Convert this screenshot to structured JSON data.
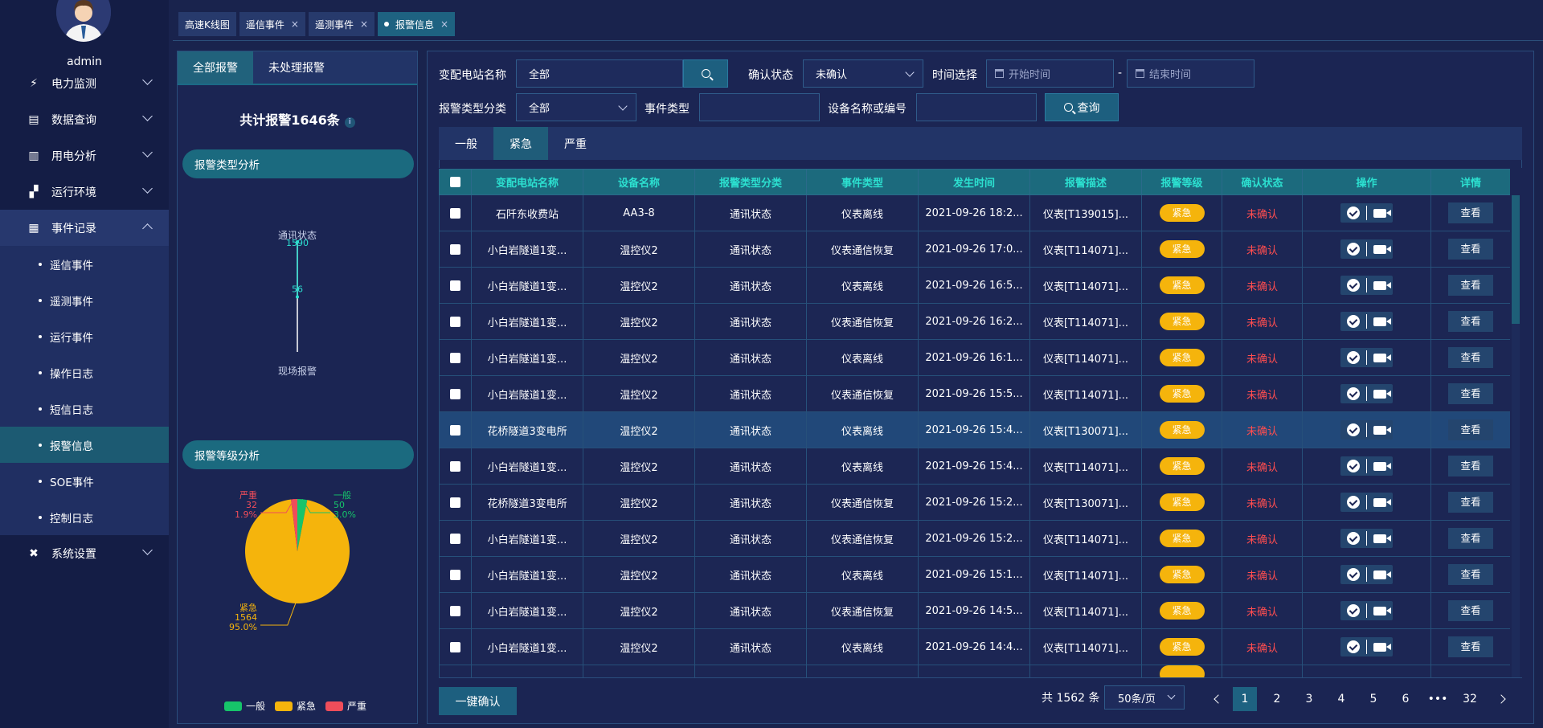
{
  "user": {
    "name": "admin"
  },
  "colors": {
    "accent": "#1e6281",
    "normal": "#16c46a",
    "urgent": "#f5b40c",
    "severe": "#ef4d5a",
    "header_text": "#2ce0d0"
  },
  "sidebar": {
    "menus": [
      {
        "label": "电力监测",
        "icon": "power-icon"
      },
      {
        "label": "数据查询",
        "icon": "database-icon"
      },
      {
        "label": "用电分析",
        "icon": "bar-chart-icon"
      },
      {
        "label": "运行环境",
        "icon": "environment-icon"
      },
      {
        "label": "事件记录",
        "icon": "event-icon",
        "expanded": true
      },
      {
        "label": "系统设置",
        "icon": "settings-icon"
      }
    ],
    "submenu": [
      "遥信事件",
      "遥测事件",
      "运行事件",
      "操作日志",
      "短信日志",
      "报警信息",
      "SOE事件",
      "控制日志"
    ],
    "active_sub": "报警信息"
  },
  "tabs": [
    {
      "label": "高速K线图",
      "closable": false
    },
    {
      "label": "遥信事件",
      "closable": true
    },
    {
      "label": "遥测事件",
      "closable": true
    },
    {
      "label": "报警信息",
      "closable": true,
      "active": true
    }
  ],
  "close_glyph": "×",
  "left_panel": {
    "tabs": [
      "全部报警",
      "未处理报警"
    ],
    "total": "共计报警1646条",
    "info_glyph": "i",
    "type_analysis_title": "报警类型分析",
    "level_analysis_title": "报警等级分析"
  },
  "chart_data": [
    {
      "type": "bar",
      "title": "报警类型分析",
      "categories": [
        "通讯状态",
        "现场报警"
      ],
      "values": [
        1590,
        56
      ],
      "labels": [
        "通讯状态",
        "1590",
        "56",
        "现场报警"
      ]
    },
    {
      "type": "pie",
      "title": "报警等级分析",
      "slices": [
        {
          "name": "一般",
          "value": 50,
          "percent": "3.0%"
        },
        {
          "name": "紧急",
          "value": 1564,
          "percent": "95.0%"
        },
        {
          "name": "严重",
          "value": 32,
          "percent": "1.9%"
        }
      ],
      "legend": [
        "一般",
        "紧急",
        "严重"
      ],
      "legend_position": "bottom"
    }
  ],
  "filters": {
    "station_label": "变配电站名称",
    "station_value": "全部",
    "ack_label": "确认状态",
    "ack_value": "未确认",
    "time_label": "时间选择",
    "start_placeholder": "开始时间",
    "dash": "-",
    "end_placeholder": "结束时间",
    "type_label": "报警类型分类",
    "type_value": "全部",
    "event_label": "事件类型",
    "device_label": "设备名称或编号",
    "query_button": "查询"
  },
  "level_tabs": [
    "一般",
    "紧急",
    "严重"
  ],
  "active_level": "紧急",
  "table": {
    "headers": [
      "变配电站名称",
      "设备名称",
      "报警类型分类",
      "事件类型",
      "发生时间",
      "报警描述",
      "报警等级",
      "确认状态",
      "操作",
      "详情"
    ],
    "rows": [
      {
        "station": "石阡东收费站",
        "device": "AA3-8",
        "category": "通讯状态",
        "event": "仪表离线",
        "time": "2021-09-26 18:2...",
        "desc": "仪表[T139015]...",
        "level": "紧急",
        "status": "未确认",
        "view": "查看"
      },
      {
        "station": "小白岩隧道1变...",
        "device": "温控仪2",
        "category": "通讯状态",
        "event": "仪表通信恢复",
        "time": "2021-09-26 17:0...",
        "desc": "仪表[T114071]...",
        "level": "紧急",
        "status": "未确认",
        "view": "查看"
      },
      {
        "station": "小白岩隧道1变...",
        "device": "温控仪2",
        "category": "通讯状态",
        "event": "仪表离线",
        "time": "2021-09-26 16:5...",
        "desc": "仪表[T114071]...",
        "level": "紧急",
        "status": "未确认",
        "view": "查看"
      },
      {
        "station": "小白岩隧道1变...",
        "device": "温控仪2",
        "category": "通讯状态",
        "event": "仪表通信恢复",
        "time": "2021-09-26 16:2...",
        "desc": "仪表[T114071]...",
        "level": "紧急",
        "status": "未确认",
        "view": "查看"
      },
      {
        "station": "小白岩隧道1变...",
        "device": "温控仪2",
        "category": "通讯状态",
        "event": "仪表离线",
        "time": "2021-09-26 16:1...",
        "desc": "仪表[T114071]...",
        "level": "紧急",
        "status": "未确认",
        "view": "查看"
      },
      {
        "station": "小白岩隧道1变...",
        "device": "温控仪2",
        "category": "通讯状态",
        "event": "仪表通信恢复",
        "time": "2021-09-26 15:5...",
        "desc": "仪表[T114071]...",
        "level": "紧急",
        "status": "未确认",
        "view": "查看"
      },
      {
        "station": "花桥隧道3变电所",
        "device": "温控仪2",
        "category": "通讯状态",
        "event": "仪表离线",
        "time": "2021-09-26 15:4...",
        "desc": "仪表[T130071]...",
        "level": "紧急",
        "status": "未确认",
        "view": "查看",
        "highlight": true
      },
      {
        "station": "小白岩隧道1变...",
        "device": "温控仪2",
        "category": "通讯状态",
        "event": "仪表离线",
        "time": "2021-09-26 15:4...",
        "desc": "仪表[T114071]...",
        "level": "紧急",
        "status": "未确认",
        "view": "查看"
      },
      {
        "station": "花桥隧道3变电所",
        "device": "温控仪2",
        "category": "通讯状态",
        "event": "仪表通信恢复",
        "time": "2021-09-26 15:2...",
        "desc": "仪表[T130071]...",
        "level": "紧急",
        "status": "未确认",
        "view": "查看"
      },
      {
        "station": "小白岩隧道1变...",
        "device": "温控仪2",
        "category": "通讯状态",
        "event": "仪表通信恢复",
        "time": "2021-09-26 15:2...",
        "desc": "仪表[T114071]...",
        "level": "紧急",
        "status": "未确认",
        "view": "查看"
      },
      {
        "station": "小白岩隧道1变...",
        "device": "温控仪2",
        "category": "通讯状态",
        "event": "仪表离线",
        "time": "2021-09-26 15:1...",
        "desc": "仪表[T114071]...",
        "level": "紧急",
        "status": "未确认",
        "view": "查看"
      },
      {
        "station": "小白岩隧道1变...",
        "device": "温控仪2",
        "category": "通讯状态",
        "event": "仪表通信恢复",
        "time": "2021-09-26 14:5...",
        "desc": "仪表[T114071]...",
        "level": "紧急",
        "status": "未确认",
        "view": "查看"
      },
      {
        "station": "小白岩隧道1变...",
        "device": "温控仪2",
        "category": "通讯状态",
        "event": "仪表离线",
        "time": "2021-09-26 14:4...",
        "desc": "仪表[T114071]...",
        "level": "紧急",
        "status": "未确认",
        "view": "查看"
      }
    ]
  },
  "footer": {
    "confirm_all": "一键确认",
    "total": "共 1562 条",
    "page_size": "50条/页",
    "pages": [
      "1",
      "2",
      "3",
      "4",
      "5",
      "6",
      "•••",
      "32"
    ],
    "current_page": "1"
  }
}
